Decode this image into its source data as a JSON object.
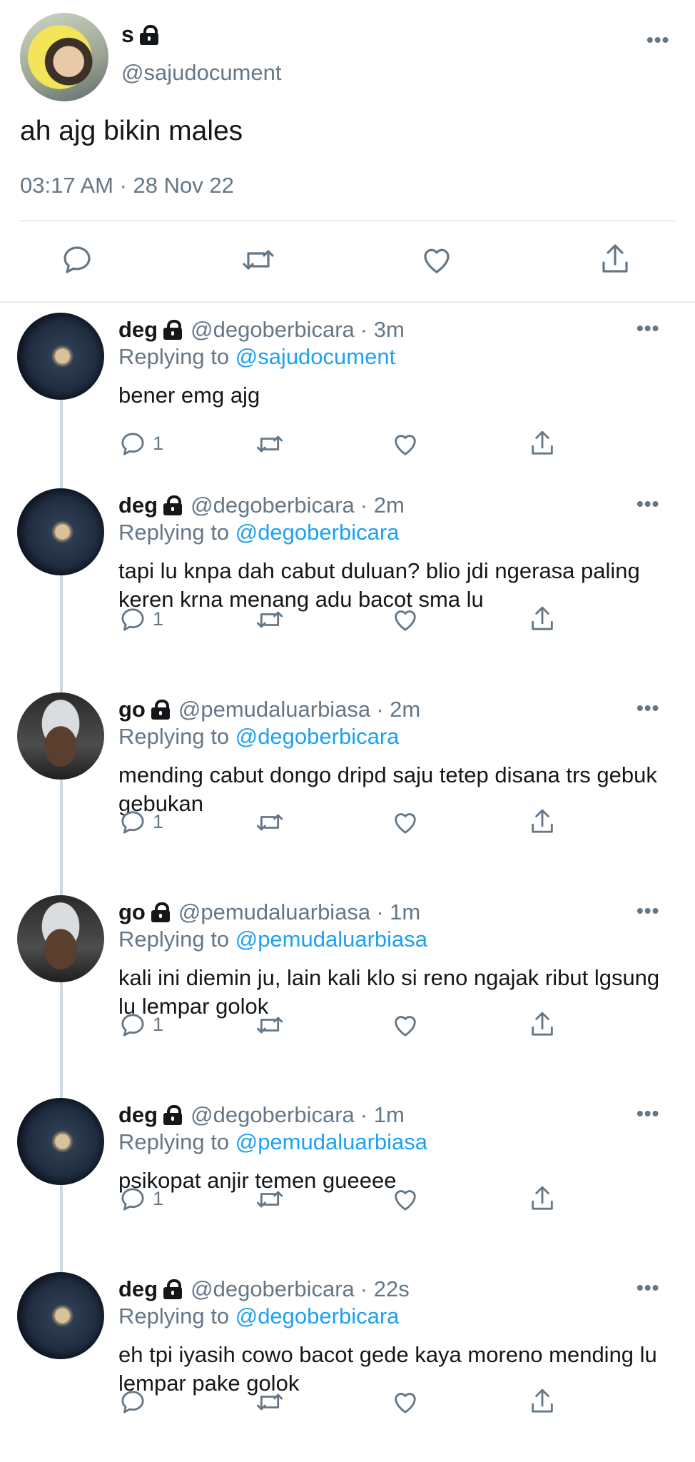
{
  "main_tweet": {
    "name": "s",
    "handle": "@sajudocument",
    "text": "ah ajg bikin males",
    "timestamp": "03:17 AM · 28 Nov 22",
    "more_icon": "more-dots-icon"
  },
  "replies": [
    {
      "name": "deg",
      "handle": "@degoberbicara",
      "time": "· 3m",
      "replying_prefix": "Replying to",
      "replying_to": "@sajudocument",
      "text": "bener emg ajg",
      "reply_count": "1",
      "avatar": "moon"
    },
    {
      "name": "deg",
      "handle": "@degoberbicara",
      "time": "· 2m",
      "replying_prefix": "Replying to",
      "replying_to": "@degoberbicara",
      "text": "tapi lu knpa dah cabut duluan? blio jdi ngerasa paling keren krna menang adu bacot sma lu",
      "reply_count": "1",
      "avatar": "moon"
    },
    {
      "name": "go",
      "handle": "@pemudaluarbiasa",
      "time": "· 2m",
      "replying_prefix": "Replying to",
      "replying_to": "@degoberbicara",
      "text": "mending cabut dongo dripd saju tetep disana trs gebuk gebukan",
      "reply_count": "1",
      "avatar": "man"
    },
    {
      "name": "go",
      "handle": "@pemudaluarbiasa",
      "time": "· 1m",
      "replying_prefix": "Replying to",
      "replying_to": "@pemudaluarbiasa",
      "text": "kali ini diemin ju, lain kali klo si reno ngajak ribut lgsung lu lempar golok",
      "reply_count": "1",
      "avatar": "man"
    },
    {
      "name": "deg",
      "handle": "@degoberbicara",
      "time": "· 1m",
      "replying_prefix": "Replying to",
      "replying_to": "@pemudaluarbiasa",
      "text": "psikopat anjir temen gueeee",
      "reply_count": "1",
      "avatar": "moon"
    },
    {
      "name": "deg",
      "handle": "@degoberbicara",
      "time": "· 22s",
      "replying_prefix": "Replying to",
      "replying_to": "@degoberbicara",
      "text": "eh tpi iyasih cowo bacot gede kaya moreno mending lu lempar pake golok",
      "reply_count": "",
      "avatar": "moon"
    }
  ],
  "icons": {
    "reply": "reply-bubble-icon",
    "retweet": "retweet-icon",
    "like": "heart-icon",
    "share": "share-icon",
    "lock": "lock-icon"
  },
  "colors": {
    "link": "#1da1f2",
    "secondary_text": "#657786",
    "divider": "#e6ecf0"
  }
}
